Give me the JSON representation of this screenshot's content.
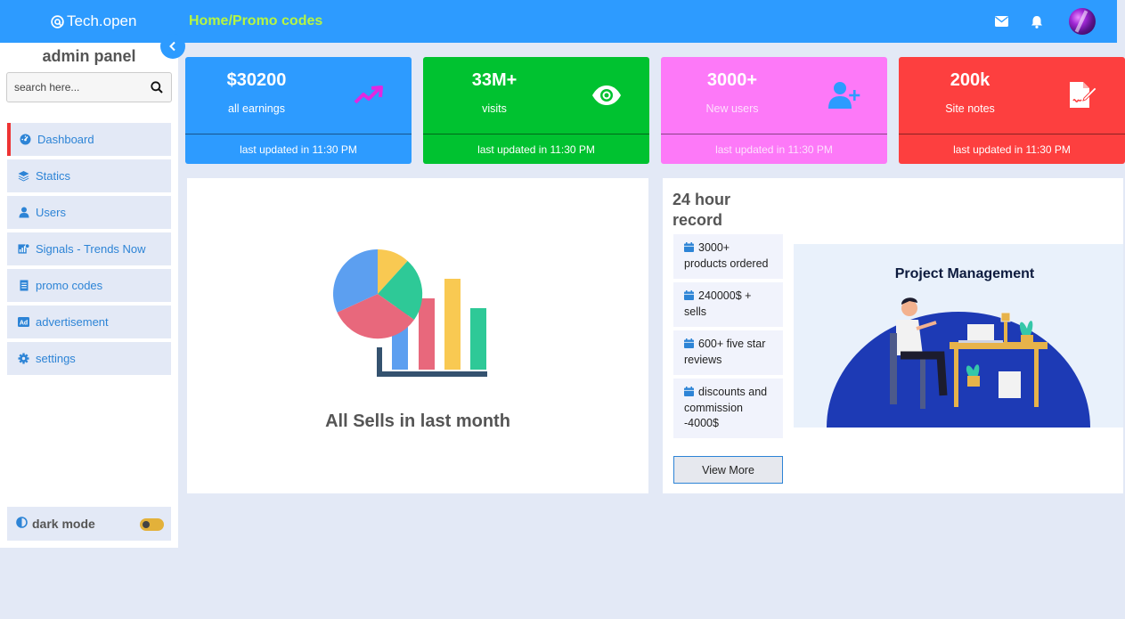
{
  "topbar": {
    "logo_text": "Tech.open",
    "breadcrumb": "Home/Promo codes",
    "icons": [
      "mail-icon",
      "bell-icon",
      "user-avatar"
    ],
    "color": "#2d9bff"
  },
  "sidebar": {
    "title": "admin panel",
    "search_placeholder": "search here...",
    "items": [
      {
        "label": "Dashboard",
        "icon": "dashboard-icon",
        "active": true
      },
      {
        "label": "Statics",
        "icon": "layers-icon"
      },
      {
        "label": "Users",
        "icon": "user-icon"
      },
      {
        "label": "Signals - Trends Now",
        "icon": "signals-icon"
      },
      {
        "label": "promo codes",
        "icon": "document-icon"
      },
      {
        "label": "advertisement",
        "icon": "ad-icon"
      },
      {
        "label": "settings",
        "icon": "gear-icon"
      }
    ],
    "dark_mode_label": "dark mode",
    "dark_mode_on": false
  },
  "cards": [
    {
      "value": "$30200",
      "label": "all earnings",
      "footer": "last updated in 11:30 PM",
      "icon": "trending-up-icon",
      "color": "#2d9bff"
    },
    {
      "value": "33M+",
      "label": "visits",
      "footer": "last updated in 11:30 PM",
      "icon": "eye-icon",
      "color": "#00c230"
    },
    {
      "value": "3000+",
      "label": "New users",
      "footer": "last updated in 11:30 PM",
      "icon": "user-plus-icon",
      "color": "#fd79f8"
    },
    {
      "value": "200k",
      "label": "Site notes",
      "footer": "last updated in 11:30 PM",
      "icon": "note-edit-icon",
      "color": "#fd3f3f"
    }
  ],
  "sells_panel": {
    "title": "All Sells in last month"
  },
  "record_panel": {
    "title": "24 hour record",
    "items": [
      "3000+ products ordered",
      "240000$ + sells",
      "600+ five star reviews",
      "discounts and commission -4000$"
    ],
    "button_label": "View More",
    "illustration_title": "Project Management"
  }
}
